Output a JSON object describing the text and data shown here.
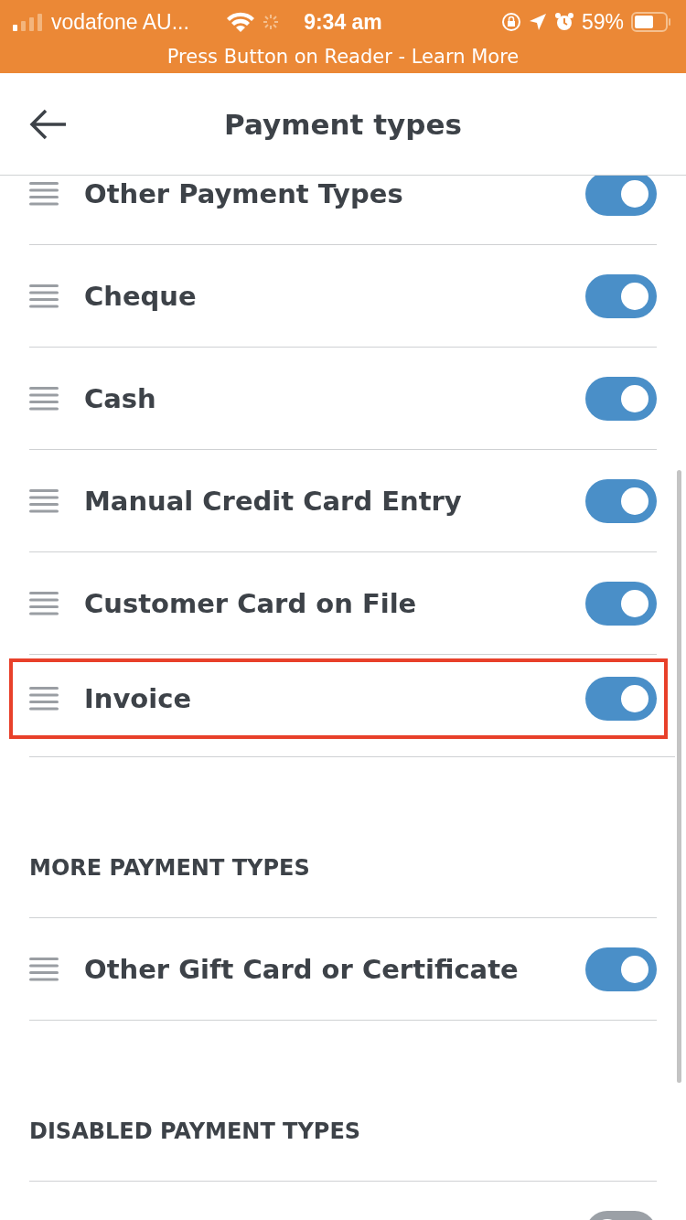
{
  "status_bar": {
    "carrier": "vodafone AU...",
    "time": "9:34 am",
    "battery": "59%"
  },
  "banner": {
    "text": "Press Button on Reader - Learn More"
  },
  "header": {
    "title": "Payment types"
  },
  "enabled_types": [
    {
      "label": "Other Payment Types",
      "on": true,
      "highlighted": false
    },
    {
      "label": "Cheque",
      "on": true,
      "highlighted": false
    },
    {
      "label": "Cash",
      "on": true,
      "highlighted": false
    },
    {
      "label": "Manual Credit Card Entry",
      "on": true,
      "highlighted": false
    },
    {
      "label": "Customer Card on File",
      "on": true,
      "highlighted": false
    },
    {
      "label": "Invoice",
      "on": true,
      "highlighted": true
    }
  ],
  "sections": [
    {
      "title": "MORE PAYMENT TYPES",
      "rows": [
        {
          "label": "Other Gift Card or Certificate",
          "on": true
        }
      ]
    },
    {
      "title": "DISABLED PAYMENT TYPES",
      "rows": [
        {
          "on": false
        }
      ]
    }
  ]
}
